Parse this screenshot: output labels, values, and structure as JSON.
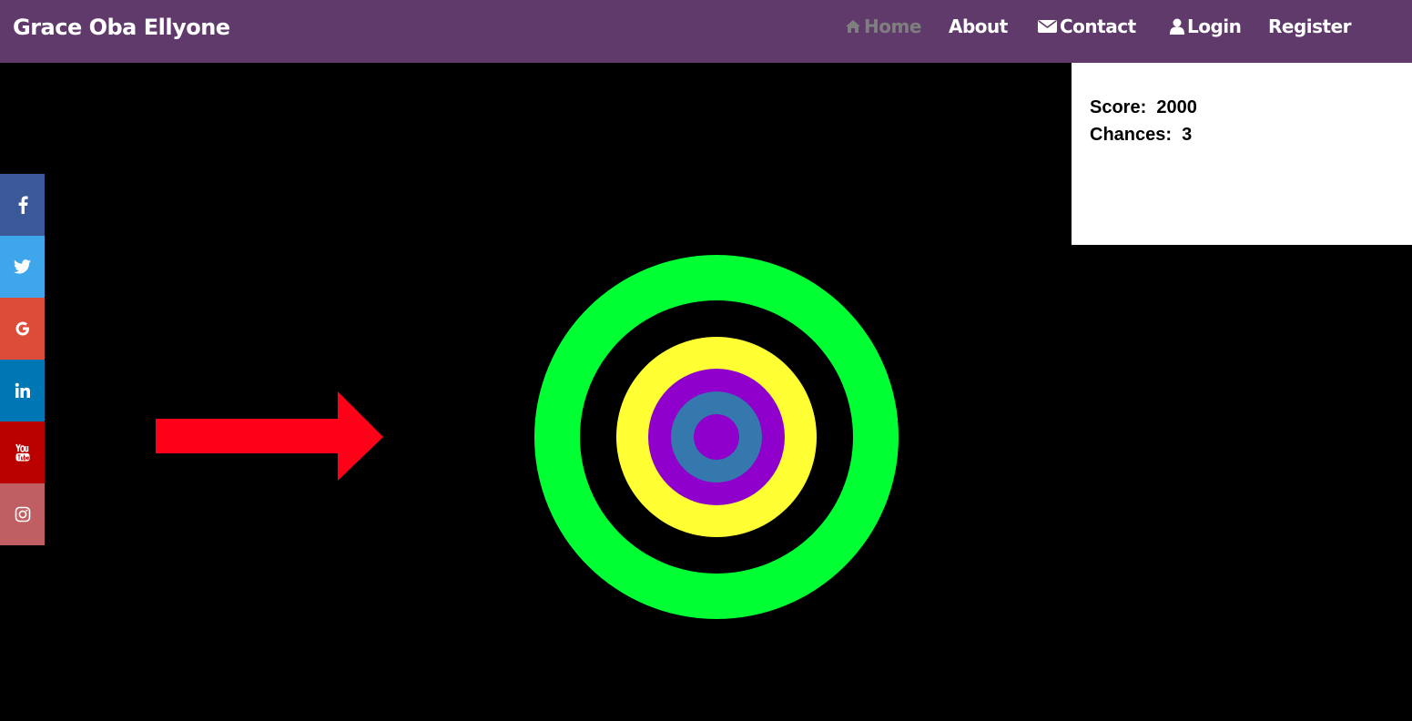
{
  "site": {
    "brand": "Grace Oba Ellyone"
  },
  "nav": {
    "items": [
      {
        "label": "Home",
        "icon": "home-icon",
        "active": true
      },
      {
        "label": "About",
        "icon": null,
        "active": false
      },
      {
        "label": "Contact",
        "icon": "envelope-icon",
        "active": false
      },
      {
        "label": "Login",
        "icon": "user-icon",
        "active": false
      },
      {
        "label": "Register",
        "icon": null,
        "active": false
      }
    ]
  },
  "scoreboard": {
    "score_label": "Score:",
    "score_value": "2000",
    "chances_label": "Chances:",
    "chances_value": "3"
  },
  "social": [
    {
      "name": "facebook",
      "icon": "facebook-icon",
      "color": "#3b5998"
    },
    {
      "name": "twitter",
      "icon": "twitter-icon",
      "color": "#3ea6ea"
    },
    {
      "name": "google",
      "icon": "google-icon",
      "color": "#dd4b39"
    },
    {
      "name": "linkedin",
      "icon": "linkedin-icon",
      "color": "#0077b5"
    },
    {
      "name": "youtube",
      "icon": "youtube-icon",
      "color": "#bb0000"
    },
    {
      "name": "instagram",
      "icon": "instagram-icon",
      "color": "#bf5f63"
    }
  ],
  "colors": {
    "navbar": "#5f3a6b",
    "arrow": "#ff0019",
    "ring_outer": "#00ff33",
    "ring_gap": "#000000",
    "ring_yellow": "#ffff33",
    "ring_purple": "#8f00cc",
    "ring_blue": "#3478ad",
    "bullseye": "#8f00cc"
  }
}
